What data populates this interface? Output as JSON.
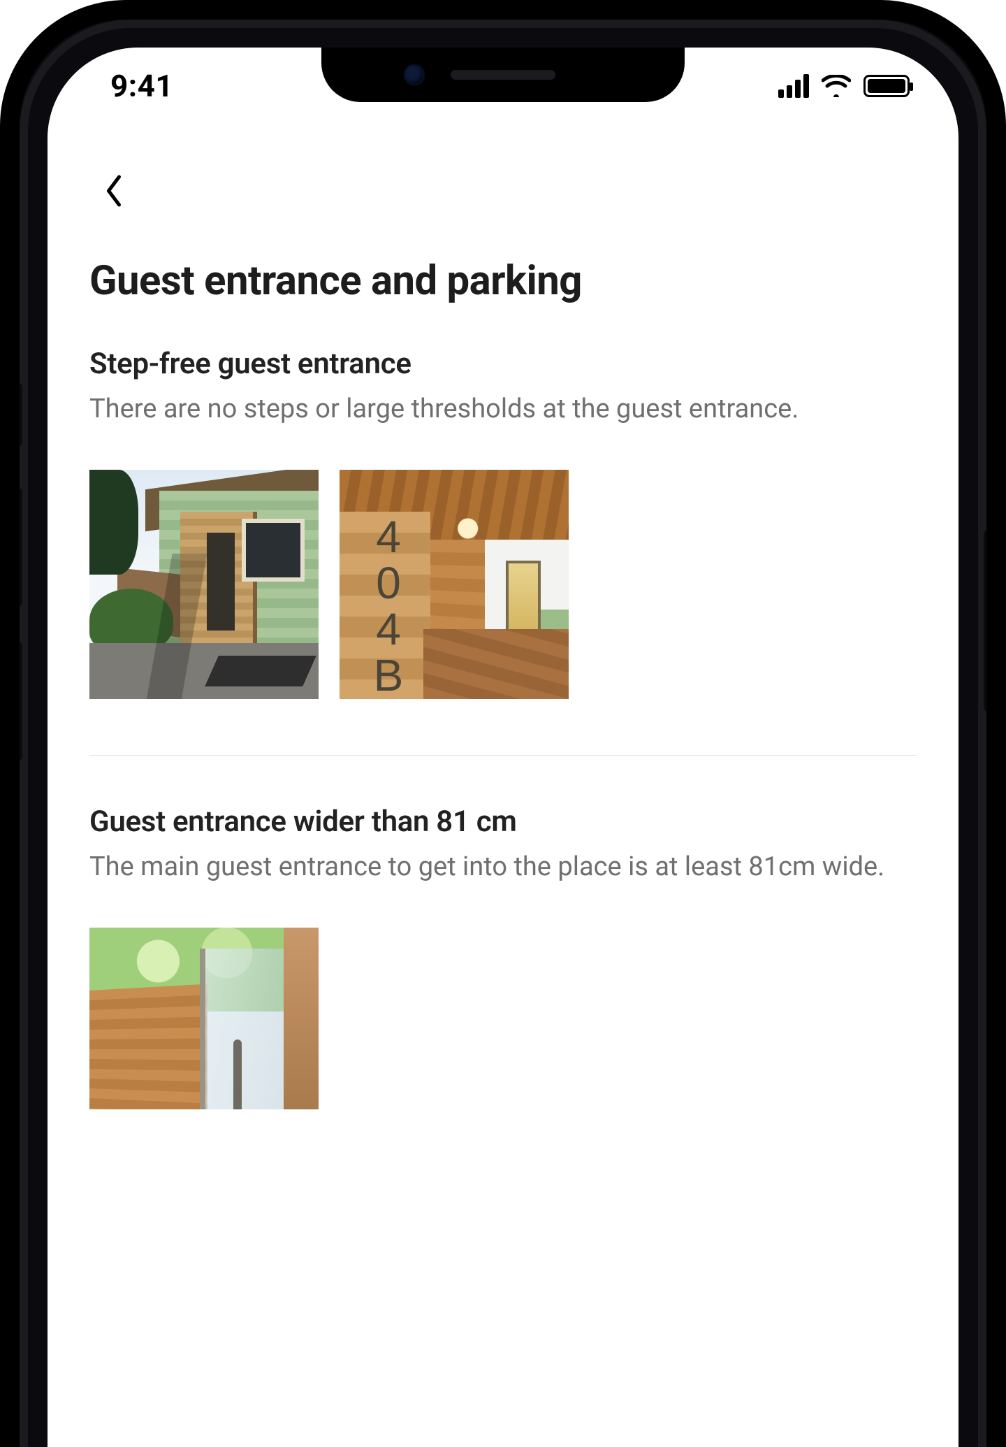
{
  "status": {
    "time": "9:41"
  },
  "page": {
    "title": "Guest entrance and parking"
  },
  "features": [
    {
      "heading": "Step-free guest entrance",
      "description": "There are no steps or large thresholds at the guest entrance.",
      "photo_sign_text": "404B"
    },
    {
      "heading": "Guest entrance wider than 81 cm",
      "description": "The main guest entrance to get into the place is at least 81cm wide."
    }
  ]
}
